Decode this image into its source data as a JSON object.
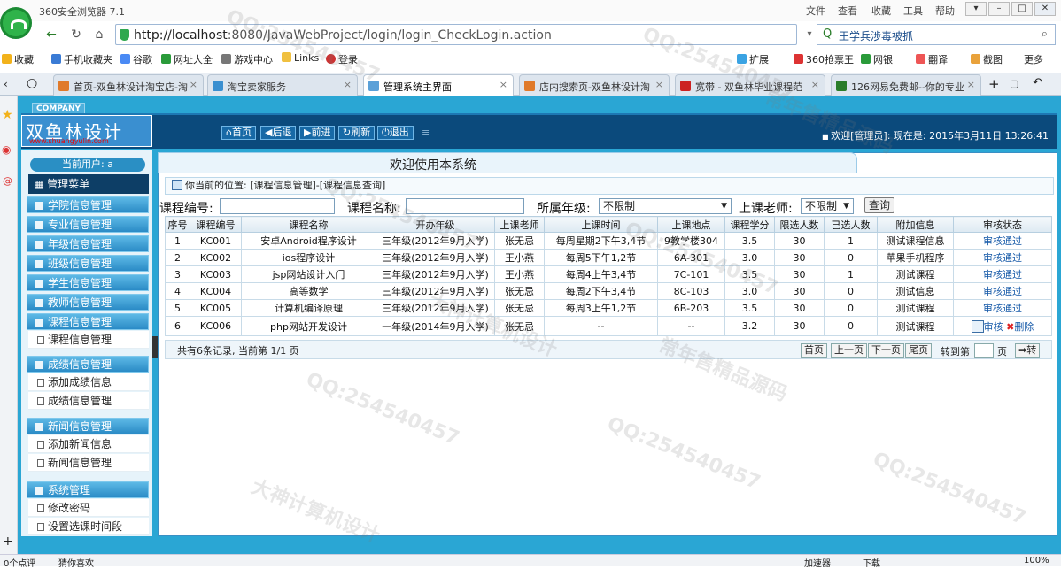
{
  "browser": {
    "app_title": "360安全浏览器 7.1",
    "menu": [
      "文件",
      "查看",
      "收藏",
      "工具",
      "帮助"
    ],
    "url_host": "http://localhost",
    "url_rest": ":8080/JavaWebProject/login/login_CheckLogin.action",
    "search_text": "王学兵涉毒被抓",
    "bookmarks": [
      "收藏",
      "手机收藏夹",
      "谷歌",
      "网址大全",
      "游戏中心",
      "Links",
      "登录",
      "扩展",
      "360抢票王",
      "网银",
      "翻译",
      "截图",
      "更多"
    ],
    "tabs": [
      {
        "label": "首页-双鱼林设计淘宝店-淘",
        "active": false
      },
      {
        "label": "淘宝卖家服务",
        "active": false
      },
      {
        "label": "管理系统主界面",
        "active": true
      },
      {
        "label": "店内搜索页-双鱼林设计淘",
        "active": false
      },
      {
        "label": "宽带 - 双鱼林毕业课程范",
        "active": false
      },
      {
        "label": "126网易免费邮--你的专业",
        "active": false
      }
    ],
    "status_left": "0个点评",
    "status_left2": "猜你喜欢",
    "status_right": [
      "加速器",
      "下载",
      "100%"
    ]
  },
  "header": {
    "company_label": "COMPANY",
    "brand_name": "双鱼林设计",
    "brand_url": "www.shuangyulin.com",
    "nav_buttons": [
      "首页",
      "后退",
      "前进",
      "刷新",
      "退出"
    ],
    "welcome": "欢迎[管理员]:  现在是: 2015年3月11日 13:26:41"
  },
  "sidebar": {
    "current_user": "当前用户: a",
    "menu_title": "管理菜单",
    "groups": [
      {
        "label": "学院信息管理"
      },
      {
        "label": "专业信息管理"
      },
      {
        "label": "年级信息管理"
      },
      {
        "label": "班级信息管理"
      },
      {
        "label": "学生信息管理"
      },
      {
        "label": "教师信息管理"
      },
      {
        "label": "课程信息管理",
        "items": [
          "课程信息管理"
        ]
      },
      {
        "label": "成绩信息管理",
        "items": [
          "添加成绩信息",
          "成绩信息管理"
        ]
      },
      {
        "label": "新闻信息管理",
        "items": [
          "添加新闻信息",
          "新闻信息管理"
        ]
      },
      {
        "label": "系统管理",
        "items": [
          "修改密码",
          "设置选课时间段"
        ]
      }
    ]
  },
  "main": {
    "banner": "欢迎使用本系统",
    "location": "你当前的位置: [课程信息管理]-[课程信息查询]",
    "filters": {
      "course_no_label": "课程编号:",
      "course_name_label": "课程名称:",
      "grade_label": "所属年级:",
      "grade_value": "不限制",
      "teacher_label": "上课老师:",
      "teacher_value": "不限制",
      "query_button": "查询"
    },
    "table": {
      "columns": [
        "序号",
        "课程编号",
        "课程名称",
        "开办年级",
        "上课老师",
        "上课时间",
        "上课地点",
        "课程学分",
        "限选人数",
        "已选人数",
        "附加信息",
        "审核状态"
      ],
      "rows": [
        [
          "1",
          "KC001",
          "安卓Android程序设计",
          "三年级(2012年9月入学)",
          "张无忌",
          "每周星期2下午3,4节",
          "9教学楼304",
          "3.5",
          "30",
          "1",
          "测试课程信息",
          "审核通过"
        ],
        [
          "2",
          "KC002",
          "ios程序设计",
          "三年级(2012年9月入学)",
          "王小燕",
          "每周5下午1,2节",
          "6A-301",
          "3.0",
          "30",
          "0",
          "苹果手机程序",
          "审核通过"
        ],
        [
          "3",
          "KC003",
          "jsp网站设计入门",
          "三年级(2012年9月入学)",
          "王小燕",
          "每周4上午3,4节",
          "7C-101",
          "3.5",
          "30",
          "1",
          "测试课程",
          "审核通过"
        ],
        [
          "4",
          "KC004",
          "高等数学",
          "三年级(2012年9月入学)",
          "张无忌",
          "每周2下午3,4节",
          "8C-103",
          "3.0",
          "30",
          "0",
          "测试信息",
          "审核通过"
        ],
        [
          "5",
          "KC005",
          "计算机编译原理",
          "三年级(2012年9月入学)",
          "张无忌",
          "每周3上午1,2节",
          "6B-203",
          "3.5",
          "30",
          "0",
          "测试课程",
          "审核通过"
        ],
        [
          "6",
          "KC006",
          "php网站开发设计",
          "一年级(2014年9月入学)",
          "张无忌",
          "--",
          "--",
          "3.2",
          "30",
          "0",
          "测试课程",
          ""
        ]
      ],
      "row6_actions": {
        "review": "审核",
        "delete": "删除"
      }
    },
    "pager": {
      "info": "共有6条记录, 当前第 1/1 页",
      "buttons": [
        "首页",
        "上一页",
        "下一页",
        "尾页"
      ],
      "goto_label": "转到第",
      "page_unit": "页",
      "go_button": "转"
    }
  },
  "watermarks": [
    "QQ:254540457",
    "常年售精品源码",
    "大神计算机设计"
  ]
}
